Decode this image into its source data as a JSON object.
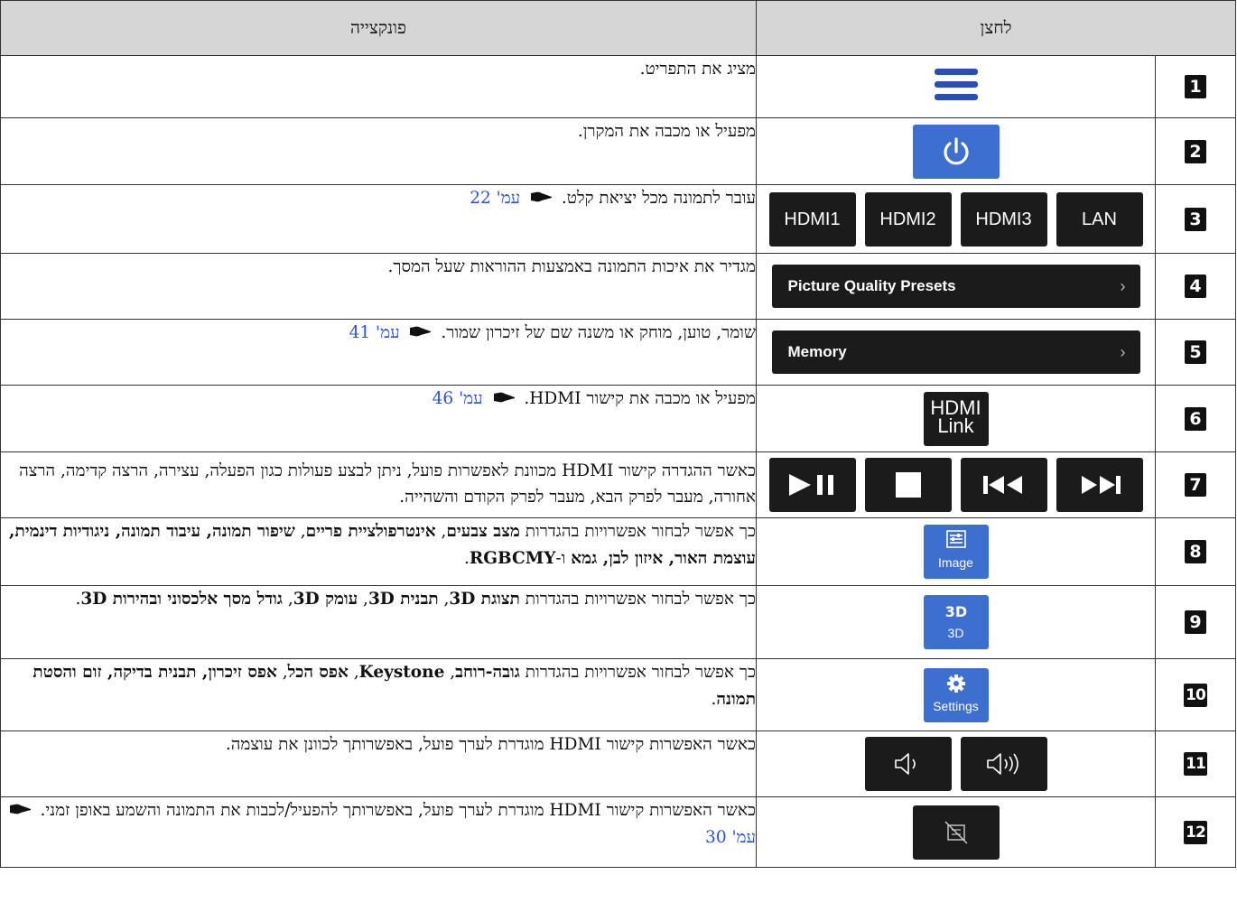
{
  "header": {
    "function_col": "פונקצייה",
    "button_col": "לחצן"
  },
  "rows": [
    {
      "num": "1",
      "text": "מציג את התפריט."
    },
    {
      "num": "2",
      "text": "מפעיל או מכבה את המקרן."
    },
    {
      "num": "3",
      "text": "עובר לתמונה מכל יציאת קלט.",
      "ref": "עמ' 22",
      "buttons": [
        "HDMI1",
        "HDMI2",
        "HDMI3",
        "LAN"
      ]
    },
    {
      "num": "4",
      "text": "מגדיר את איכות התמונה באמצעות ההוראות שעל המסך.",
      "button": "Picture Quality Presets"
    },
    {
      "num": "5",
      "text": "שומר, טוען, מוחק או משנה שם של זיכרון שמור.",
      "ref": "עמ' 41",
      "button": "Memory"
    },
    {
      "num": "6",
      "text": "מפעיל או מכבה את קישור HDMI.",
      "ref": "עמ' 46",
      "button_l1": "HDMI",
      "button_l2": "Link"
    },
    {
      "num": "7",
      "text": "כאשר ההגדרה קישור HDMI מכוונת לאפשרות פועל, ניתן לבצע פעולות כגון הפעלה, עצירה, הרצה קדימה, הרצה אחורה, מעבר לפרק הבא, מעבר לפרק הקודם והשהייה."
    },
    {
      "num": "8",
      "text_a": "כך אפשר לבחור אפשרויות בהגדרות ",
      "bold_a": "מצב צבעים",
      "text_b": ", ",
      "bold_b": "אינטרפולציית פריים",
      "text_c": ", ",
      "bold_c": "שיפור תמונה, עיבוד תמונה, ניגודיות דינמית, עוצמת האור, איזון לבן, גמא",
      "text_d": " ו-",
      "bold_d": "RGBCMY",
      "text_e": ".",
      "button": "Image"
    },
    {
      "num": "9",
      "text_a": "כך אפשר לבחור אפשרויות בהגדרות ",
      "bold_a": "תצוגת 3D",
      "text_b": ", ",
      "bold_b": "תבנית 3D",
      "text_c": ", ",
      "bold_c": "עומק 3D",
      "text_d": ", ",
      "bold_d": "גודל מסך אלכסוני ובהירות 3D",
      "text_e": ".",
      "button": "3D"
    },
    {
      "num": "10",
      "text_a": "כך אפשר לבחור אפשרויות בהגדרות ",
      "bold_a": "גובה-רוחב",
      "text_b": ", ",
      "bold_b": "Keystone",
      "text_c": ", ",
      "bold_c": "אפס הכל",
      "text_d": ", ",
      "bold_d": "אפס זיכרון, תבנית בדיקה, זום והסטת תמונה",
      "text_e": ".",
      "button": "Settings"
    },
    {
      "num": "11",
      "text": "כאשר האפשרות קישור HDMI מוגדרת לערך פועל, באפשרותך לכוונן את עוצמה."
    },
    {
      "num": "12",
      "text": "כאשר האפשרות קישור HDMI מוגדרת לערך פועל, באפשרותך להפעיל/לכבות את התמונה והשמע באופן זמני.",
      "ref": "עמ' 30"
    }
  ],
  "colors": {
    "header_bg": "#d6d6d6",
    "button_dark": "#1b1b1b",
    "button_blue": "#3c6fd0",
    "menu_icon": "#2b4fae",
    "link": "#2b55c8"
  },
  "icons": [
    "menu-icon",
    "power-icon",
    "play-pause-icon",
    "stop-icon",
    "previous-chapter-icon",
    "next-chapter-icon",
    "image-settings-icon",
    "3d-icon",
    "gear-icon",
    "volume-down-icon",
    "volume-up-icon",
    "av-mute-icon",
    "pointing-hand-icon"
  ]
}
